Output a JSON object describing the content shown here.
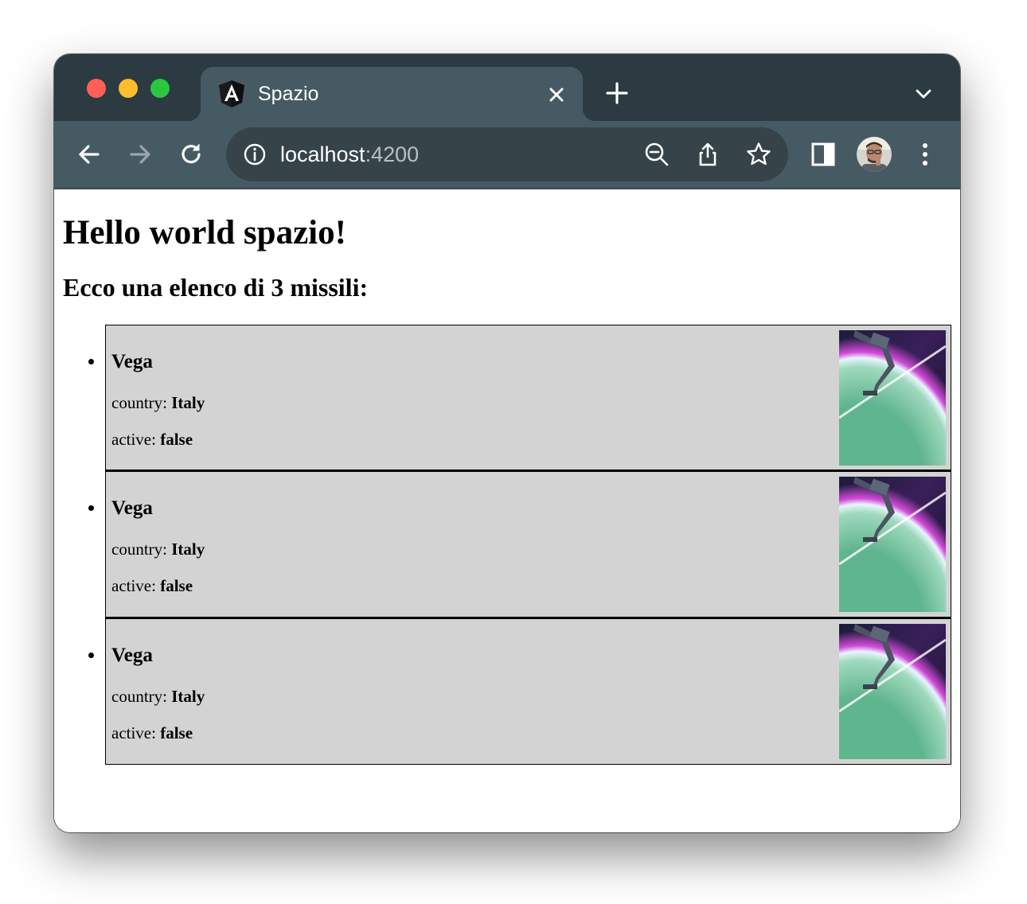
{
  "browser": {
    "tab": {
      "title": "Spazio",
      "favicon": "angular-icon"
    },
    "address_bar": {
      "host": "localhost",
      "port": ":4200"
    },
    "colors": {
      "tabstrip": "#2c3a42",
      "toolbar": "#465a63",
      "omnibox": "#364449"
    }
  },
  "page": {
    "heading": "Hello world spazio!",
    "subheading": "Ecco una elenco di 3 missili:",
    "missiles": [
      {
        "name": "Vega",
        "country_label": "country: ",
        "country": "Italy",
        "active_label": "active: ",
        "active": "false"
      },
      {
        "name": "Vega",
        "country_label": "country: ",
        "country": "Italy",
        "active_label": "active: ",
        "active": "false"
      },
      {
        "name": "Vega",
        "country_label": "country: ",
        "country": "Italy",
        "active_label": "active: ",
        "active": "false"
      }
    ],
    "list_background": "#d3d3d3"
  }
}
